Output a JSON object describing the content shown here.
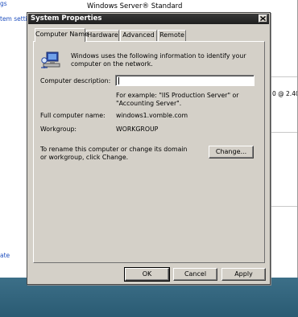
{
  "background": {
    "window_title": "Windows Server® Standard",
    "left_links": [
      "gs",
      "tem settir",
      "ate"
    ],
    "right_text": "0 @ 2.40"
  },
  "dialog": {
    "title": "System Properties",
    "tabs": [
      {
        "label": "Computer Name",
        "active": true
      },
      {
        "label": "Hardware",
        "active": false
      },
      {
        "label": "Advanced",
        "active": false
      },
      {
        "label": "Remote",
        "active": false
      }
    ],
    "intro_text": "Windows uses the following information to identify your computer on the network.",
    "computer_description": {
      "label": "Computer description:",
      "value": "",
      "example": "For example: \"IIS Production Server\" or \"Accounting Server\"."
    },
    "full_computer_name": {
      "label": "Full computer name:",
      "value": "windows1.vomble.com"
    },
    "workgroup": {
      "label": "Workgroup:",
      "value": "WORKGROUP"
    },
    "rename_text": "To rename this computer or change its domain or workgroup, click Change.",
    "change_button": "Change...",
    "buttons": {
      "ok": "OK",
      "cancel": "Cancel",
      "apply": "Apply"
    }
  },
  "colors": {
    "dialog_face": "#d4d0c8",
    "titlebar": "#1e1e1e",
    "taskbar": "#2f6079",
    "link": "#1f4fbf"
  }
}
